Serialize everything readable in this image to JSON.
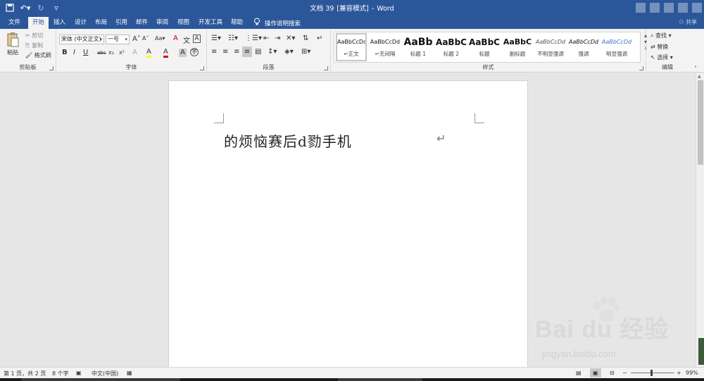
{
  "titlebar": {
    "doc_name": "文档 39",
    "mode": "[兼容模式]",
    "separator": "-",
    "app": "Word"
  },
  "tabs": [
    "文件",
    "开始",
    "插入",
    "设计",
    "布局",
    "引用",
    "邮件",
    "审阅",
    "视图",
    "开发工具",
    "帮助"
  ],
  "tell_me": "操作说明搜索",
  "share": "共享",
  "ribbon": {
    "clipboard": {
      "paste": "粘贴",
      "cut": "剪切",
      "copy": "复制",
      "format_painter": "格式刷",
      "label": "剪贴板"
    },
    "font": {
      "font_name": "宋体 (中文正文)",
      "font_size": "一号",
      "label": "字体",
      "bold": "B",
      "italic": "I",
      "underline": "U",
      "strike": "abc",
      "sub": "x₂",
      "sup": "x²",
      "grow": "A",
      "shrink": "A",
      "case": "Aa",
      "clear": "A",
      "phonetic": "文",
      "border_char": "A",
      "highlight": "A",
      "color": "A",
      "shade": "A",
      "enclose": "字"
    },
    "paragraph": {
      "label": "段落"
    },
    "styles": {
      "label": "样式",
      "items": [
        {
          "preview": "AaBbCcDd",
          "name": "正文"
        },
        {
          "preview": "AaBbCcDd",
          "name": "无间隔"
        },
        {
          "preview": "AaBb",
          "name": "标题 1"
        },
        {
          "preview": "AaBbC",
          "name": "标题 2"
        },
        {
          "preview": "AaBbC",
          "name": "标题"
        },
        {
          "preview": "AaBbC",
          "name": "副标题"
        },
        {
          "preview": "AaBbCcDd",
          "name": "不明显强调"
        },
        {
          "preview": "AaBbCcDd",
          "name": "强调"
        },
        {
          "preview": "AaBbCcDd",
          "name": "明显强调"
        }
      ]
    },
    "editing": {
      "find": "查找",
      "replace": "替换",
      "select": "选择",
      "label": "编辑"
    }
  },
  "document": {
    "text": "的烦恼赛后d勠手机"
  },
  "statusbar": {
    "page": "第 1 页，共 2 页",
    "words": "8 个字",
    "language": "中文(中国)",
    "zoom": "99%",
    "zoom_minus": "−",
    "zoom_plus": "+"
  },
  "watermark": {
    "brand": "Bai du 经验",
    "url": "jingyan.baidu.com"
  },
  "colors": {
    "title_blue": "#2b579a",
    "ribbon_bg": "#f3f3f3",
    "highlight_yellow": "#ffff00",
    "font_red": "#e00000"
  }
}
